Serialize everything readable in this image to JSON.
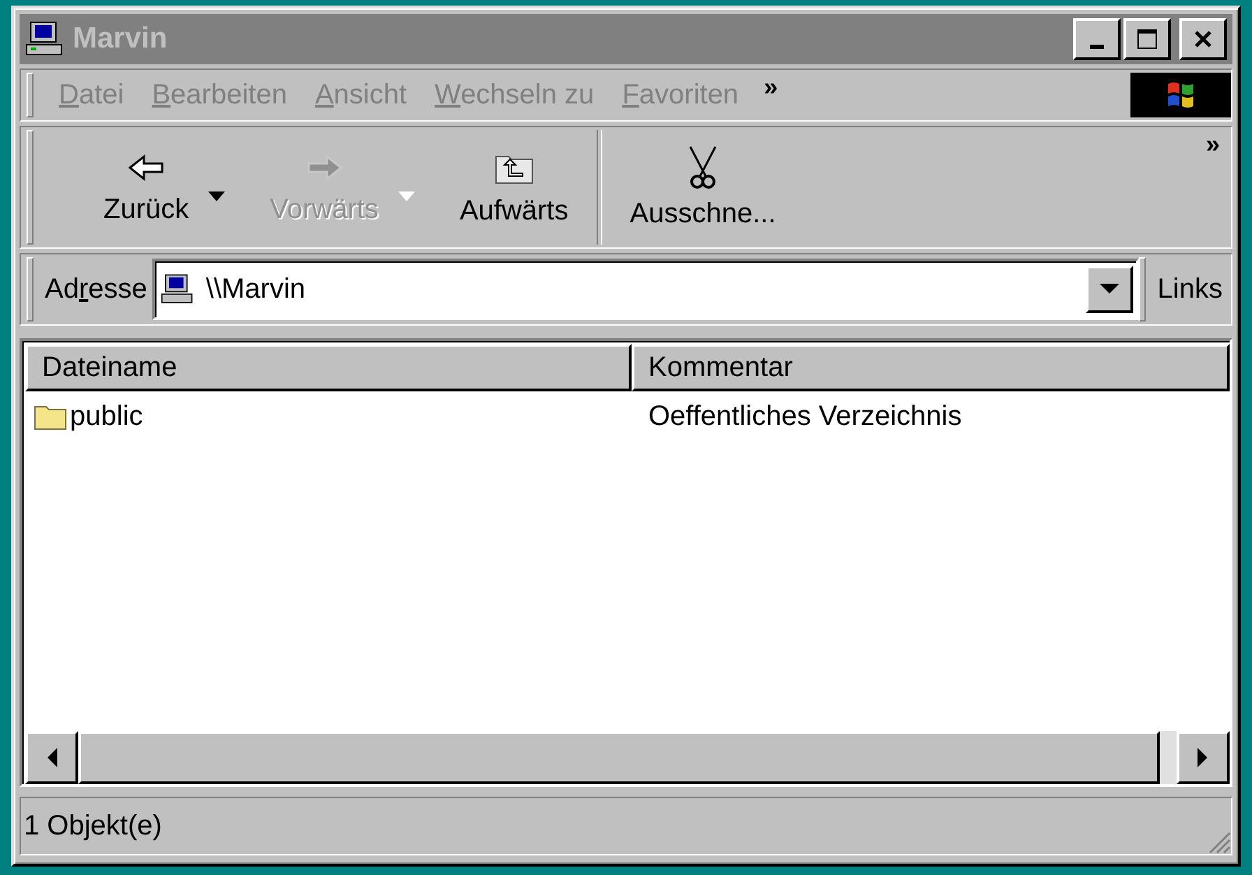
{
  "window": {
    "title": "Marvin",
    "active": false
  },
  "menu": [
    {
      "key": "D",
      "post": "atei"
    },
    {
      "key": "B",
      "post": "earbeiten"
    },
    {
      "key": "A",
      "post": "nsicht"
    },
    {
      "key": "W",
      "post": "echseln zu"
    },
    {
      "key": "F",
      "post": "avoriten"
    }
  ],
  "menu_chevron": "»",
  "toolbar": {
    "buttons": [
      {
        "kind": "back",
        "label": "Zurück",
        "disabled": false,
        "dropdown": true
      },
      {
        "kind": "forward",
        "label": "Vorwärts",
        "disabled": true,
        "dropdown": true
      },
      {
        "kind": "up",
        "label": "Aufwärts",
        "disabled": false,
        "dropdown": false
      },
      {
        "kind": "cut",
        "label": "Ausschne...",
        "disabled": false,
        "dropdown": false
      }
    ],
    "chevron": "»"
  },
  "address": {
    "label": {
      "pre": "Ad",
      "key": "r",
      "post": "esse"
    },
    "value": "\\\\Marvin",
    "links": "Links"
  },
  "table": {
    "columns": [
      "Dateiname",
      "Kommentar"
    ],
    "rows": [
      {
        "name": "public",
        "comment": "Oeffentliches Verzeichnis"
      }
    ]
  },
  "status_bar": "1 Objekt(e)"
}
